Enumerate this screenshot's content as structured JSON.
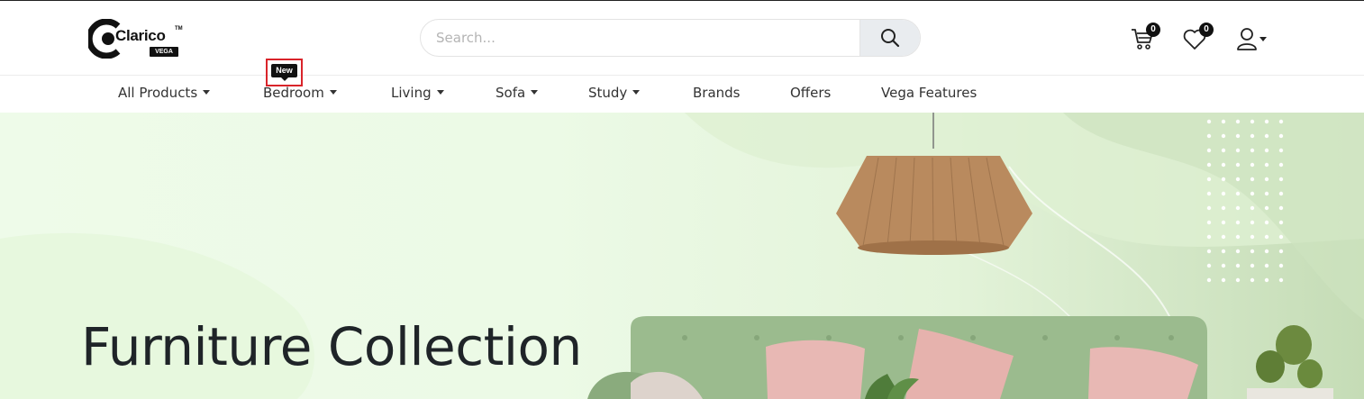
{
  "brand": {
    "name": "Clarico",
    "trademark": "TM",
    "edition": "VEGA"
  },
  "search": {
    "placeholder": "Search..."
  },
  "header": {
    "cart_count": "0",
    "wishlist_count": "0"
  },
  "nav": {
    "new_tag": "New",
    "items": [
      {
        "label": "All Products",
        "dropdown": true
      },
      {
        "label": "Bedroom",
        "dropdown": true
      },
      {
        "label": "Living",
        "dropdown": true
      },
      {
        "label": "Sofa",
        "dropdown": true
      },
      {
        "label": "Study",
        "dropdown": true
      },
      {
        "label": "Brands",
        "dropdown": false
      },
      {
        "label": "Offers",
        "dropdown": false
      },
      {
        "label": "Vega Features",
        "dropdown": false
      }
    ]
  },
  "hero": {
    "title": "Furniture Collection"
  },
  "icons": {
    "search": "search-icon",
    "cart": "cart-icon",
    "wishlist": "heart-icon",
    "account": "user-icon",
    "dropdown": "caret-down-icon"
  },
  "colors": {
    "accent": "#111111",
    "highlight_border": "#d9242a",
    "hero_bg": "#ecfae6",
    "sofa": "#9bbb8e",
    "pillow": "#e8b8b4",
    "lamp": "#b98a5e"
  }
}
